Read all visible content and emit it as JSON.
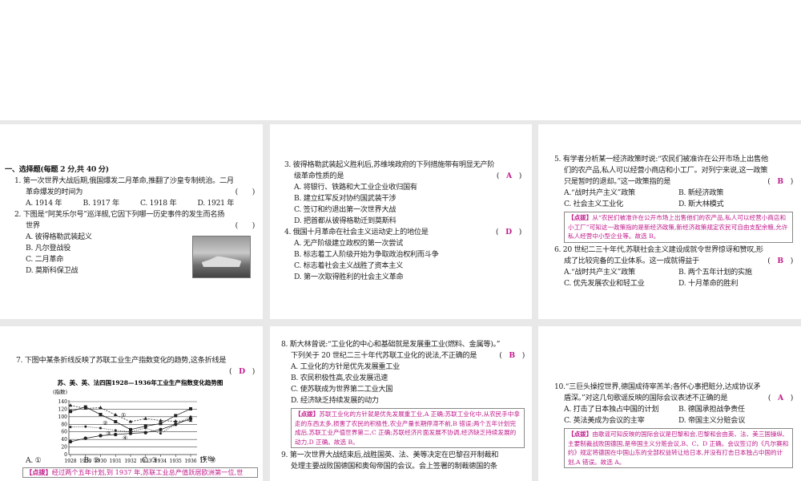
{
  "p1": {
    "section": "一、选择题(每题 2 分,共 40 分)",
    "q1": {
      "l1": "1. 第一次世界大战后期,俄国爆发二月革命,推翻了沙皇专制统治。二月",
      "l2": "革命爆发的时间为",
      "paren": "(　　)",
      "opts": [
        "A. 1914 年",
        "B. 1917 年",
        "C. 1918 年",
        "D. 1921 年"
      ]
    },
    "q2": {
      "l1": "2. 下图是“阿芙乐尔号”巡洋舰,它因下列哪一历史事件的发生而名扬",
      "l2": "世界",
      "paren": "(　　)",
      "opts": [
        "A. 彼得格勒武装起义",
        "B. 凡尔登战役",
        "C. 二月革命",
        "D. 莫斯科保卫战"
      ]
    }
  },
  "p2": {
    "q3": {
      "l1": "3. 彼得格勒武装起义胜利后,苏维埃政府的下列措施带有明显无产阶",
      "l2": "级革命性质的是",
      "answer": "A",
      "opts": [
        "A. 将银行、铁路和大工业企业收归国有",
        "B. 建立红军反对协约国武装干涉",
        "C. 签订和约退出第一次世界大战",
        "D. 把首都从彼得格勒迁到莫斯科"
      ]
    },
    "q4": {
      "l1": "4. 俄国十月革命在社会主义运动史上的地位是",
      "answer": "D",
      "opts": [
        "A. 无产阶级建立政权的第一次尝试",
        "B. 标志着工人阶级开始为争取政治权利而斗争",
        "C. 标志着社会主义战胜了资本主义",
        "D. 第一次取得胜利的社会主义革命"
      ]
    }
  },
  "p3": {
    "q5": {
      "l1": "5. 有学者分析某一经济政策时说:“农民们被准许在公开市场上出售他",
      "l2": "们的农产品,私人可以经营小商店和小工厂。对列宁来说,这一政策",
      "l3": "只是暂时的退却。”这一政策指的是",
      "answer": "B",
      "opts": [
        "A.“战时共产主义”政策",
        "B. 新经济政策",
        "C. 社会主义工业化",
        "D. 斯大林模式"
      ],
      "tip_label": "【点拨】",
      "tip": "从“农民们被准许在公开市场上出售他们的农产品,私人可以经营小商店和小工厂”可知这一政策指的是新经济政策,新经济政策规定农民可自由支配余粮,允许私人经营中小型企业等。故选 B。"
    },
    "q6": {
      "l1": "6. 20 世纪二三十年代,苏联社会主义建设成就令世界惊讶和赞叹,形",
      "l2": "成了比较完备的工业体系。这一成就得益于",
      "answer": "B",
      "opts": [
        "A.“战时共产主义”政策",
        "B. 两个五年计划的实施",
        "C. 优先发展农业和轻工业",
        "D. 十月革命的胜利"
      ]
    }
  },
  "p4": {
    "q7": {
      "l1": "7. 下图中某条折线反映了苏联工业生产指数变化的趋势,这条折线是",
      "answer": "D",
      "opts": [
        "A. ①",
        "B. ②",
        "C. ③",
        "D. ④"
      ],
      "tip_label": "【点拨】",
      "tip": "经过两个五年计划,到 1937 年,苏联工业总产值跃居欧洲第一位,世"
    }
  },
  "chart_data": {
    "type": "line",
    "title": "苏、美、英、法四国1928—1936年工业生产指数变化趋势图",
    "ylabel": "(指数)",
    "xlabel": "(年份)",
    "x": [
      1928,
      1929,
      1930,
      1931,
      1932,
      1933,
      1934,
      1935,
      1936
    ],
    "ylim": [
      0,
      140
    ],
    "yticks": [
      0,
      20,
      40,
      60,
      80,
      100,
      120,
      140
    ],
    "series": [
      {
        "name": "①",
        "values": [
          130,
          122,
          124,
          105,
          87,
          95,
          90,
          88,
          90
        ]
      },
      {
        "name": "②",
        "values": [
          114,
          126,
          106,
          87,
          66,
          75,
          82,
          103,
          121
        ]
      },
      {
        "name": "③",
        "values": [
          73,
          74,
          70,
          64,
          60,
          70,
          56,
          80,
          100
        ]
      },
      {
        "name": "④",
        "values": [
          34,
          43,
          50,
          53,
          56,
          58,
          66,
          80,
          95
        ]
      }
    ]
  },
  "p5": {
    "q8": {
      "l1": "8. 斯大林曾说:“工业化的中心和基础就是发展重工业(燃料、金属等)。”",
      "l2": "下列关于 20 世纪二三十年代苏联工业化的说法,不正确的是",
      "answer": "B",
      "opts": [
        "A. 工业化的方针是优先发展重工业",
        "B. 农民积极性高,农业发展迅速",
        "C. 使苏联成为世界第二工业大国",
        "D. 经济缺乏持续发展的动力"
      ],
      "tip_label": "【点拨】",
      "tip": "苏联工业化的方针就是优先发展重工业,A 正确;苏联工业化中,从农民手中拿走的东西太多,损害了农民的积极性,农业产量长期停滞不前,B 错误;两个五年计划完成后,苏联工业产值世界第二,C 正确;苏联经济片面发展不协调,经济缺乏持续发展的动力,D 正确。故选 B。"
    },
    "q9": {
      "l1": "9. 第一次世界大战结束后,战胜国英、法、美等决定在巴黎召开制裁和",
      "l2": "处理主要战败国德国和奥匈帝国的会议。会上签署的制裁德国的条"
    }
  },
  "p6": {
    "q10": {
      "l1": "10.“三巨头操控世界,德国成待宰羔羊;各怀心事把赃分,达成协议矛",
      "l2": "盾深。”对这几句歌谣反映的国际会议表述不正确的是",
      "answer": "A",
      "opts": [
        "A. 打击了日本独占中国的计划",
        "B. 德国承担战争责任",
        "C. 英法美成为会议的主宰",
        "D. 帝国主义分赃会议"
      ],
      "tip_label": "【点拨】",
      "tip": "由歌谣可知反映的国际会议是巴黎和会,巴黎和会由英、法、美三国操纵,主要制裁战败国德国,是帝国主义分赃会议,B、C、D 正确。会议签订的《凡尔赛和约》规定将德国在中国山东的全部权益转让给日本,并没有打击日本独占中国的计划,A 错误。故选 A。"
    }
  }
}
